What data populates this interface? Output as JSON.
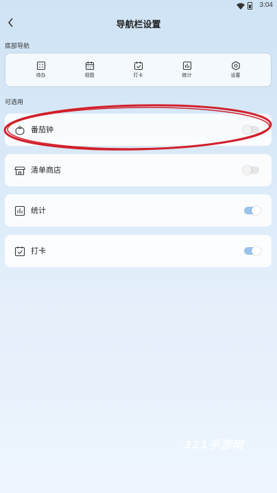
{
  "status_bar": {
    "time": "3:04"
  },
  "header": {
    "title": "导航栏设置"
  },
  "sections": {
    "bottom_nav": "底部导航",
    "optional": "可选用"
  },
  "bottom_nav": {
    "items": [
      {
        "label": "待办",
        "icon": "todo-icon"
      },
      {
        "label": "视图",
        "icon": "calendar-view-icon"
      },
      {
        "label": "打卡",
        "icon": "checkin-icon"
      },
      {
        "label": "统计",
        "icon": "stats-icon"
      },
      {
        "label": "设置",
        "icon": "settings-icon"
      }
    ]
  },
  "optional": {
    "items": [
      {
        "label": "番茄钟",
        "icon": "tomato-icon",
        "enabled": false
      },
      {
        "label": "清单商店",
        "icon": "shop-icon",
        "enabled": false
      },
      {
        "label": "统计",
        "icon": "stats-icon",
        "enabled": true
      },
      {
        "label": "打卡",
        "icon": "checkin-icon",
        "enabled": true
      }
    ]
  },
  "annotation": {
    "highlight_color": "#d21f2a"
  },
  "watermark": {
    "text": "321手游网"
  }
}
